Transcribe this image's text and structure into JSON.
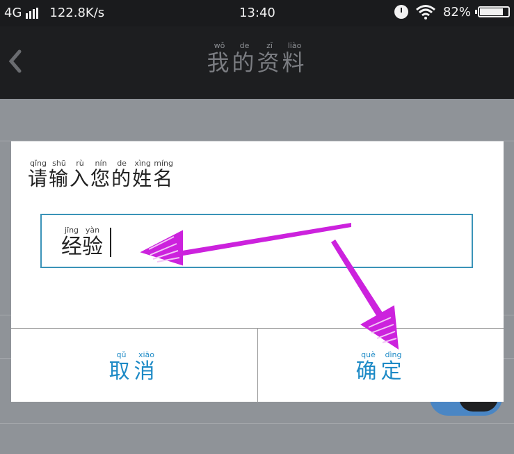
{
  "status_bar": {
    "network": "4G",
    "speed": "122.8K/s",
    "time": "13:40",
    "battery": "82%",
    "battery_level": 0.82
  },
  "nav": {
    "back_icon": "chevron-left-icon",
    "title_chars": [
      "我",
      "的",
      "资",
      "料"
    ],
    "title_pinyin": [
      "wǒ",
      "de",
      "zī",
      "liào"
    ]
  },
  "dialog": {
    "prompt_chars": [
      "请",
      "输",
      "入",
      "您",
      "的",
      "姓",
      "名"
    ],
    "prompt_pinyin": [
      "qǐng",
      "shū",
      "rù",
      "nín",
      "de",
      "xìng",
      "míng"
    ],
    "input_chars": [
      "经",
      "验"
    ],
    "input_pinyin": [
      "jīng",
      "yàn"
    ],
    "cancel_chars": [
      "取",
      "消"
    ],
    "cancel_pinyin": [
      "qǔ",
      "xiāo"
    ],
    "ok_chars": [
      "确",
      "定"
    ],
    "ok_pinyin": [
      "què",
      "dìng"
    ]
  },
  "colors": {
    "accent": "#1d8ac6",
    "input_border": "#3a93b8",
    "arrow": "#cc22dd"
  }
}
